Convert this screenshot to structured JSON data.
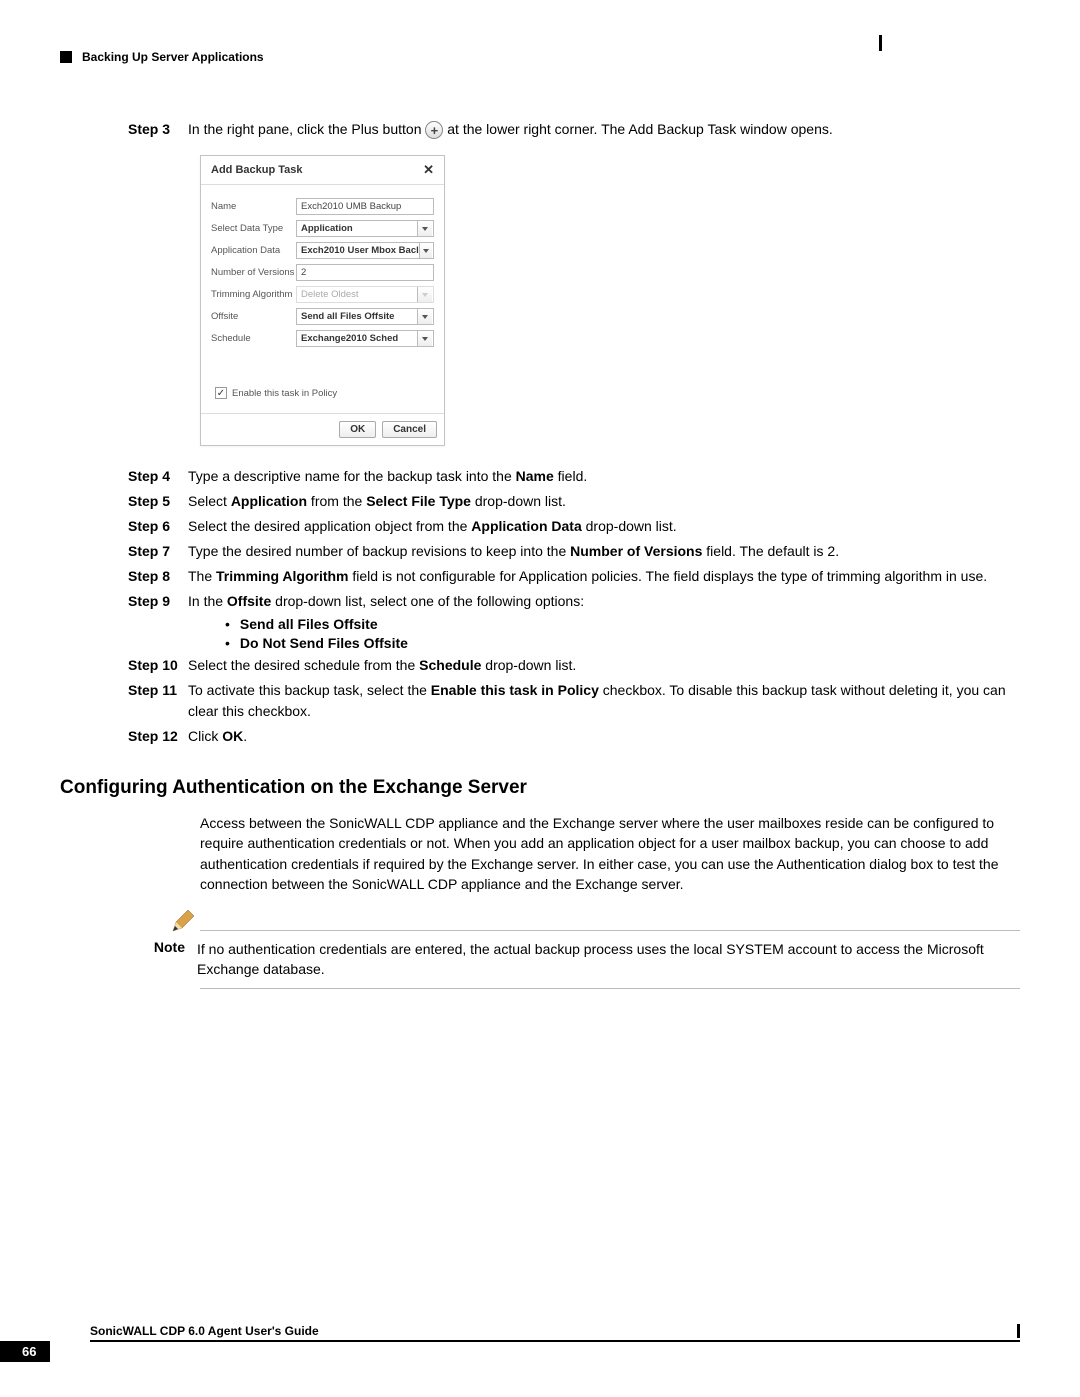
{
  "header": {
    "chapter": "Backing Up Server Applications"
  },
  "step3": {
    "label": "Step 3",
    "text_before": "In the right pane, click the Plus button ",
    "text_after": " at the lower right corner. The Add Backup Task window opens."
  },
  "dialog": {
    "title": "Add Backup Task",
    "fields": {
      "name": {
        "label": "Name",
        "value": "Exch2010 UMB Backup"
      },
      "select_data_type": {
        "label": "Select Data Type",
        "value": "Application"
      },
      "application_data": {
        "label": "Application Data",
        "value": "Exch2010 User Mbox Bacl"
      },
      "number_versions": {
        "label": "Number of Versions",
        "value": "2"
      },
      "trimming": {
        "label": "Trimming Algorithm",
        "value": "Delete Oldest"
      },
      "offsite": {
        "label": "Offsite",
        "value": "Send all Files Offsite"
      },
      "schedule": {
        "label": "Schedule",
        "value": "Exchange2010 Sched"
      }
    },
    "enable_label": "Enable this task in Policy",
    "ok": "OK",
    "cancel": "Cancel"
  },
  "steps": {
    "s4": {
      "label": "Step 4",
      "pre": "Type a descriptive name for the backup task into the ",
      "b1": "Name",
      "post": " field."
    },
    "s5": {
      "label": "Step 5",
      "pre": "Select ",
      "b1": "Application",
      "mid": " from the ",
      "b2": "Select File Type",
      "post": " drop-down list."
    },
    "s6": {
      "label": "Step 6",
      "pre": "Select the desired application object from the ",
      "b1": "Application Data",
      "post": " drop-down list."
    },
    "s7": {
      "label": "Step 7",
      "pre": "Type the desired number of backup revisions to keep into the ",
      "b1": "Number of Versions",
      "post": " field. The default is 2."
    },
    "s8": {
      "label": "Step 8",
      "pre": "The ",
      "b1": "Trimming Algorithm",
      "post": " field is not configurable for Application policies. The field displays the type of trimming algorithm in use."
    },
    "s9": {
      "label": "Step 9",
      "pre": "In the ",
      "b1": "Offsite",
      "post": " drop-down list, select one of the following options:"
    },
    "s10": {
      "label": "Step 10",
      "pre": "Select the desired schedule from the ",
      "b1": "Schedule",
      "post": " drop-down list."
    },
    "s11": {
      "label": "Step 11",
      "pre": "To activate this backup task, select the ",
      "b1": "Enable this task in Policy",
      "post": " checkbox. To disable this backup task without deleting it, you can clear this checkbox."
    },
    "s12": {
      "label": "Step 12",
      "pre": "Click ",
      "b1": "OK",
      "post": "."
    }
  },
  "bullets": {
    "b1": "Send all Files Offsite",
    "b2": "Do Not Send Files Offsite"
  },
  "section": {
    "heading": "Configuring Authentication on the Exchange Server",
    "para": "Access between the SonicWALL CDP appliance and the Exchange server where the user mailboxes reside can be configured to require authentication credentials or not. When you add an application object for a user mailbox backup, you can choose to add authentication credentials if required by the Exchange server. In either case, you can use the Authentication dialog box to test the connection between the SonicWALL CDP appliance and the Exchange server."
  },
  "note": {
    "label": "Note",
    "text": "If no authentication credentials are entered, the actual backup process uses the local SYSTEM account to access the Microsoft Exchange database."
  },
  "footer": {
    "guide": "SonicWALL CDP 6.0 Agent User's Guide",
    "page": "66"
  }
}
